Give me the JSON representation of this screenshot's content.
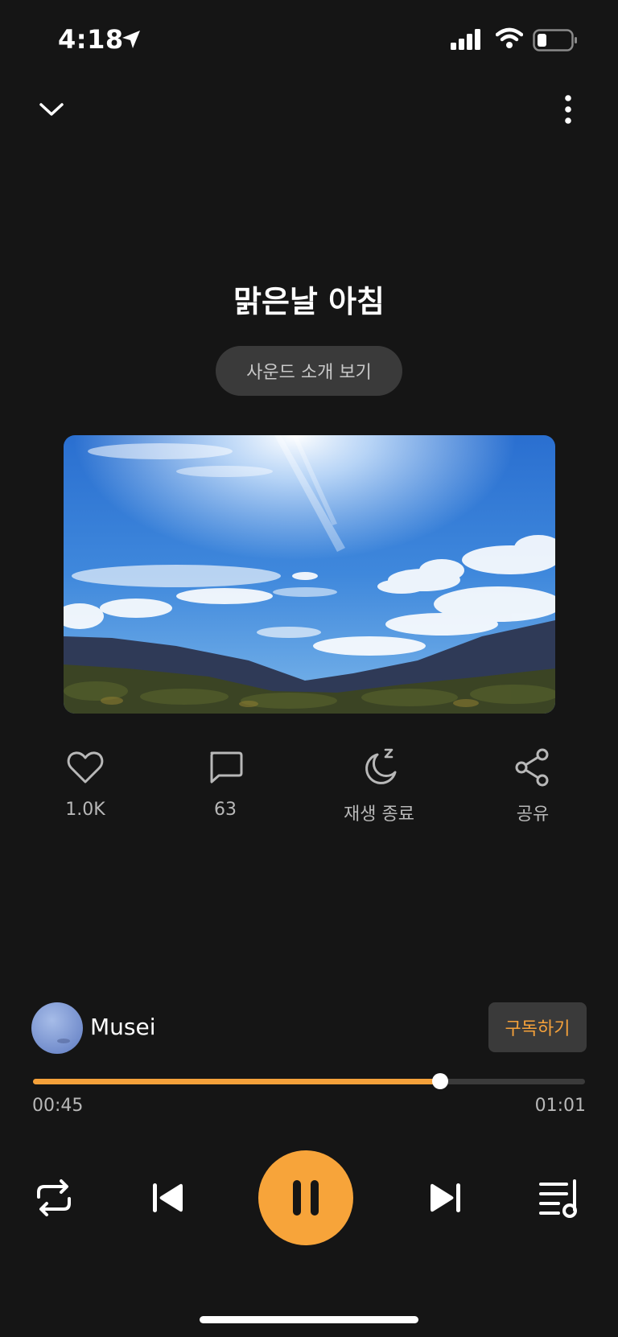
{
  "status_bar": {
    "time": "4:18",
    "icons": [
      "location-arrow-icon",
      "cellular-signal-icon",
      "wifi-icon",
      "battery-icon"
    ]
  },
  "header": {
    "collapse_icon": "chevron-down-icon",
    "more_icon": "more-vertical-icon"
  },
  "track": {
    "title": "맑은날 아침",
    "intro_button_label": "사운드 소개 보기",
    "artwork": "sky-landscape-image"
  },
  "actions": {
    "like": {
      "icon": "heart-icon",
      "label": "1.0K"
    },
    "comment": {
      "icon": "comment-icon",
      "label": "63"
    },
    "sleep_timer": {
      "icon": "moon-sleep-icon",
      "label": "재생 종료"
    },
    "share": {
      "icon": "share-icon",
      "label": "공유"
    }
  },
  "creator": {
    "name": "Musei",
    "subscribe_label": "구독하기"
  },
  "playback": {
    "elapsed": "00:45",
    "total": "01:01",
    "progress_fraction": 0.738,
    "controls": [
      "repeat-icon",
      "skip-previous-icon",
      "pause-icon",
      "skip-next-icon",
      "playlist-icon"
    ]
  },
  "colors": {
    "background": "#151515",
    "accent": "#f5a13a",
    "button_bg": "#3a3a3a",
    "secondary_text": "#b8b8b8"
  }
}
